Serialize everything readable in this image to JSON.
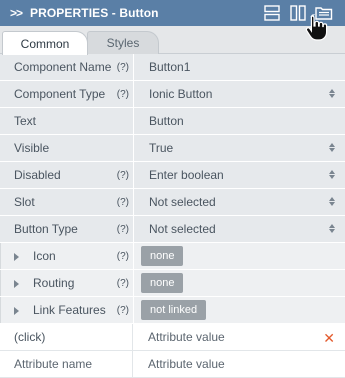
{
  "header": {
    "collapse_icon": ">>",
    "title": "PROPERTIES - Button",
    "icons": [
      "layout-rows-icon",
      "layout-columns-icon",
      "folder-open-icon"
    ]
  },
  "tabs": [
    {
      "label": "Common",
      "active": true
    },
    {
      "label": "Styles",
      "active": false
    }
  ],
  "properties": [
    {
      "label": "Component Name",
      "help": "(?)",
      "value": "Button1",
      "dropdown": false
    },
    {
      "label": "Component Type",
      "help": "(?)",
      "value": "Ionic Button",
      "dropdown": true
    },
    {
      "label": "Text",
      "help": "",
      "value": "Button",
      "dropdown": false
    },
    {
      "label": "Visible",
      "help": "",
      "value": "True",
      "dropdown": true
    },
    {
      "label": "Disabled",
      "help": "(?)",
      "value": "Enter boolean",
      "dropdown": true
    },
    {
      "label": "Slot",
      "help": "(?)",
      "value": "Not selected",
      "dropdown": true
    },
    {
      "label": "Button Type",
      "help": "(?)",
      "value": "Not selected",
      "dropdown": true
    }
  ],
  "sections": [
    {
      "label": "Icon",
      "help": "(?)",
      "value": "none"
    },
    {
      "label": "Routing",
      "help": "(?)",
      "value": "none"
    },
    {
      "label": "Link Features",
      "help": "(?)",
      "value": "not linked"
    }
  ],
  "attributes": [
    {
      "name": "(click)",
      "value_placeholder": "Attribute value",
      "removable": true
    },
    {
      "name_placeholder": "Attribute name",
      "value_placeholder": "Attribute value",
      "removable": false
    }
  ],
  "colors": {
    "header_bg": "#5a7fa6",
    "row_bg": "#e6e9ec",
    "pill_bg": "#9aa1a7",
    "remove_x": "#e35a2d"
  }
}
